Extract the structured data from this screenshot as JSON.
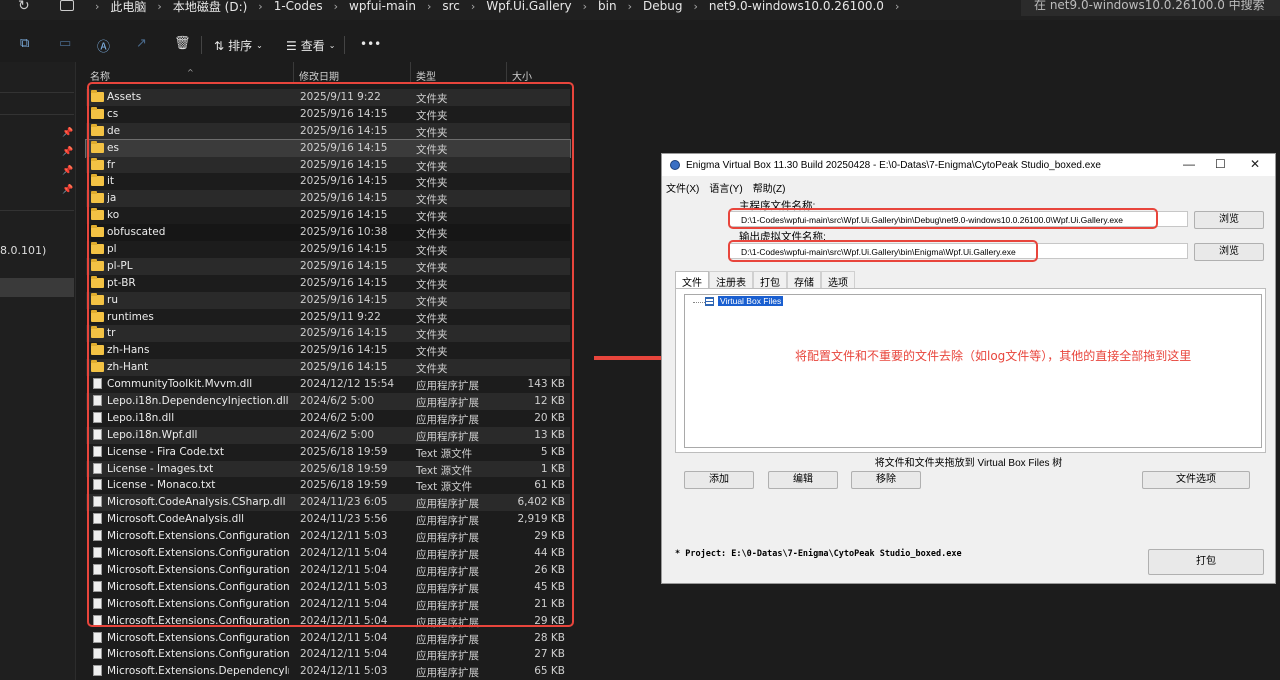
{
  "explorer": {
    "breadcrumbs": [
      "此电脑",
      "本地磁盘 (D:)",
      "1-Codes",
      "wpfui-main",
      "src",
      "Wpf.Ui.Gallery",
      "bin",
      "Debug",
      "net9.0-windows10.0.26100.0"
    ],
    "search_placeholder": "在 net9.0-windows10.0.26100.0 中搜索",
    "toolbar": {
      "sort_label": "排序",
      "view_label": "查看",
      "more_label": "•••"
    },
    "nav": {
      "partial_label": "8.0.101)"
    },
    "columns": {
      "name": "名称",
      "date": "修改日期",
      "type": "类型",
      "size": "大小"
    },
    "files": [
      {
        "name": "Assets",
        "date": "2025/9/11 9:22",
        "type": "文件夹",
        "size": "",
        "kind": "folder"
      },
      {
        "name": "cs",
        "date": "2025/9/16 14:15",
        "type": "文件夹",
        "size": "",
        "kind": "folder"
      },
      {
        "name": "de",
        "date": "2025/9/16 14:15",
        "type": "文件夹",
        "size": "",
        "kind": "folder"
      },
      {
        "name": "es",
        "date": "2025/9/16 14:15",
        "type": "文件夹",
        "size": "",
        "kind": "folder"
      },
      {
        "name": "fr",
        "date": "2025/9/16 14:15",
        "type": "文件夹",
        "size": "",
        "kind": "folder"
      },
      {
        "name": "it",
        "date": "2025/9/16 14:15",
        "type": "文件夹",
        "size": "",
        "kind": "folder"
      },
      {
        "name": "ja",
        "date": "2025/9/16 14:15",
        "type": "文件夹",
        "size": "",
        "kind": "folder"
      },
      {
        "name": "ko",
        "date": "2025/9/16 14:15",
        "type": "文件夹",
        "size": "",
        "kind": "folder"
      },
      {
        "name": "obfuscated",
        "date": "2025/9/16 10:38",
        "type": "文件夹",
        "size": "",
        "kind": "folder"
      },
      {
        "name": "pl",
        "date": "2025/9/16 14:15",
        "type": "文件夹",
        "size": "",
        "kind": "folder"
      },
      {
        "name": "pl-PL",
        "date": "2025/9/16 14:15",
        "type": "文件夹",
        "size": "",
        "kind": "folder"
      },
      {
        "name": "pt-BR",
        "date": "2025/9/16 14:15",
        "type": "文件夹",
        "size": "",
        "kind": "folder"
      },
      {
        "name": "ru",
        "date": "2025/9/16 14:15",
        "type": "文件夹",
        "size": "",
        "kind": "folder"
      },
      {
        "name": "runtimes",
        "date": "2025/9/11 9:22",
        "type": "文件夹",
        "size": "",
        "kind": "folder"
      },
      {
        "name": "tr",
        "date": "2025/9/16 14:15",
        "type": "文件夹",
        "size": "",
        "kind": "folder"
      },
      {
        "name": "zh-Hans",
        "date": "2025/9/16 14:15",
        "type": "文件夹",
        "size": "",
        "kind": "folder"
      },
      {
        "name": "zh-Hant",
        "date": "2025/9/16 14:15",
        "type": "文件夹",
        "size": "",
        "kind": "folder"
      },
      {
        "name": "CommunityToolkit.Mvvm.dll",
        "date": "2024/12/12 15:54",
        "type": "应用程序扩展",
        "size": "143 KB",
        "kind": "file"
      },
      {
        "name": "Lepo.i18n.DependencyInjection.dll",
        "date": "2024/6/2 5:00",
        "type": "应用程序扩展",
        "size": "12 KB",
        "kind": "file"
      },
      {
        "name": "Lepo.i18n.dll",
        "date": "2024/6/2 5:00",
        "type": "应用程序扩展",
        "size": "20 KB",
        "kind": "file"
      },
      {
        "name": "Lepo.i18n.Wpf.dll",
        "date": "2024/6/2 5:00",
        "type": "应用程序扩展",
        "size": "13 KB",
        "kind": "file"
      },
      {
        "name": "License - Fira Code.txt",
        "date": "2025/6/18 19:59",
        "type": "Text 源文件",
        "size": "5 KB",
        "kind": "file"
      },
      {
        "name": "License - Images.txt",
        "date": "2025/6/18 19:59",
        "type": "Text 源文件",
        "size": "1 KB",
        "kind": "file"
      },
      {
        "name": "License - Monaco.txt",
        "date": "2025/6/18 19:59",
        "type": "Text 源文件",
        "size": "61 KB",
        "kind": "file"
      },
      {
        "name": "Microsoft.CodeAnalysis.CSharp.dll",
        "date": "2024/11/23 6:05",
        "type": "应用程序扩展",
        "size": "6,402 KB",
        "kind": "file"
      },
      {
        "name": "Microsoft.CodeAnalysis.dll",
        "date": "2024/11/23 5:56",
        "type": "应用程序扩展",
        "size": "2,919 KB",
        "kind": "file"
      },
      {
        "name": "Microsoft.Extensions.Configuration.A...",
        "date": "2024/12/11 5:03",
        "type": "应用程序扩展",
        "size": "29 KB",
        "kind": "file"
      },
      {
        "name": "Microsoft.Extensions.Configuration.Bi...",
        "date": "2024/12/11 5:04",
        "type": "应用程序扩展",
        "size": "44 KB",
        "kind": "file"
      },
      {
        "name": "Microsoft.Extensions.Configuration.C...",
        "date": "2024/12/11 5:04",
        "type": "应用程序扩展",
        "size": "26 KB",
        "kind": "file"
      },
      {
        "name": "Microsoft.Extensions.Configuration.dll",
        "date": "2024/12/11 5:03",
        "type": "应用程序扩展",
        "size": "45 KB",
        "kind": "file"
      },
      {
        "name": "Microsoft.Extensions.Configuration.E...",
        "date": "2024/12/11 5:04",
        "type": "应用程序扩展",
        "size": "21 KB",
        "kind": "file"
      },
      {
        "name": "Microsoft.Extensions.Configuration.Fil...",
        "date": "2024/12/11 5:04",
        "type": "应用程序扩展",
        "size": "29 KB",
        "kind": "file"
      },
      {
        "name": "Microsoft.Extensions.Configuration.Js...",
        "date": "2024/12/11 5:04",
        "type": "应用程序扩展",
        "size": "28 KB",
        "kind": "file"
      },
      {
        "name": "Microsoft.Extensions.Configuration.U...",
        "date": "2024/12/11 5:04",
        "type": "应用程序扩展",
        "size": "27 KB",
        "kind": "file"
      },
      {
        "name": "Microsoft.Extensions.DependencyInje...",
        "date": "2024/12/11 5:03",
        "type": "应用程序扩展",
        "size": "65 KB",
        "kind": "file"
      }
    ]
  },
  "enigma": {
    "title": "Enigma Virtual Box 11.30 Build 20250428 - E:\\0-Datas\\7-Enigma\\CytoPeak Studio_boxed.exe",
    "menu": [
      "文件(X)",
      "语言(Y)",
      "帮助(Z)"
    ],
    "main_label": "主程序文件名称:",
    "main_path": "D:\\1-Codes\\wpfui-main\\src\\Wpf.Ui.Gallery\\bin\\Debug\\net9.0-windows10.0.26100.0\\Wpf.Ui.Gallery.exe",
    "output_label": "输出虚拟文件名称:",
    "output_path": "D:\\1-Codes\\wpfui-main\\src\\Wpf.Ui.Gallery\\bin\\Enigma\\Wpf.Ui.Gallery.exe",
    "browse_label": "浏览",
    "tabs": [
      "文件",
      "注册表",
      "打包",
      "存储",
      "选项"
    ],
    "tree_root": "Virtual Box Files",
    "annotation": "将配置文件和不重要的文件去除（如log文件等），其他的直接全部拖到这里",
    "drag_tip": "将文件和文件夹拖放到 Virtual Box Files 树",
    "buttons": {
      "add": "添加",
      "edit": "编辑",
      "remove": "移除",
      "file_options": "文件选项",
      "pack": "打包"
    },
    "project": "* Project: E:\\0-Datas\\7-Enigma\\CytoPeak Studio_boxed.exe"
  },
  "colors": {
    "highlight_red": "#e8453c",
    "folder_yellow": "#f3c244",
    "selection_blue": "#1a5fd0"
  }
}
